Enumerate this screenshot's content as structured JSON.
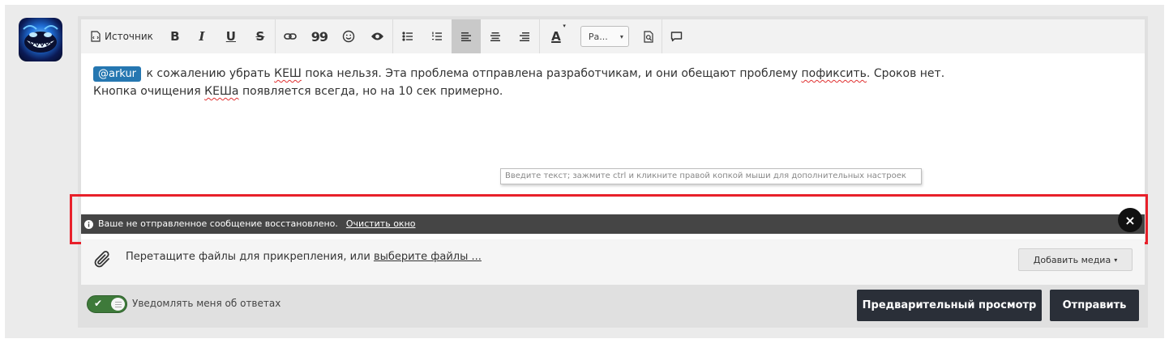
{
  "toolbar": {
    "source_label": "Источник",
    "bold_label": "B",
    "italic_label": "I",
    "underline_label": "U",
    "strike_label": "S",
    "quote_label": "99",
    "text_color_label": "A",
    "paragraph_select_value": "Ра...",
    "icons": [
      "source-icon",
      "bold-icon",
      "italic-icon",
      "underline-icon",
      "strikethrough-icon",
      "link-icon",
      "quote-icon",
      "smile-icon",
      "spoiler-eye-icon",
      "bullet-list-icon",
      "numbered-list-icon",
      "align-left-icon",
      "align-center-icon",
      "align-right-icon",
      "text-color-icon",
      "paragraph-select",
      "preview-icon",
      "comment-icon"
    ]
  },
  "content": {
    "mention": "@arkur",
    "line1_part1": " к сожалению убрать ",
    "line1_word_kesh": "КЕШ",
    "line1_part2": " пока нельзя. Эта проблема отправлена разработчикам, и они обещают проблему ",
    "line1_word_fix": "пофиксить",
    "line1_part3": ". Сроков нет.",
    "line2_part1": "Кнопка очищения ",
    "line2_word_kesha": "КЕШа",
    "line2_part2": " появляется всегда, но на 10 сек примерно."
  },
  "tooltip": "Введите текст; зажмите ctrl и кликните правой копкой мыши для дополнительных настроек",
  "notice": {
    "message": "Ваше не отправленное сообщение восстановлено.",
    "clear_link": "Очистить окно",
    "close_symbol": "×"
  },
  "attach": {
    "text": "Перетащите файлы для прикрепления, или ",
    "link": "выберите файлы ...",
    "media_button": "Добавить медиа",
    "media_caret": "▾"
  },
  "footer": {
    "notify_label": "Уведомлять меня об ответах",
    "preview_button": "Предварительный просмотр",
    "submit_button": "Отправить"
  },
  "colors": {
    "mention_bg": "#2577b1",
    "notice_bg": "#454545",
    "highlight_border": "#e8202a",
    "toggle_on": "#3e7a3a",
    "button_dark": "#2a2f38"
  }
}
